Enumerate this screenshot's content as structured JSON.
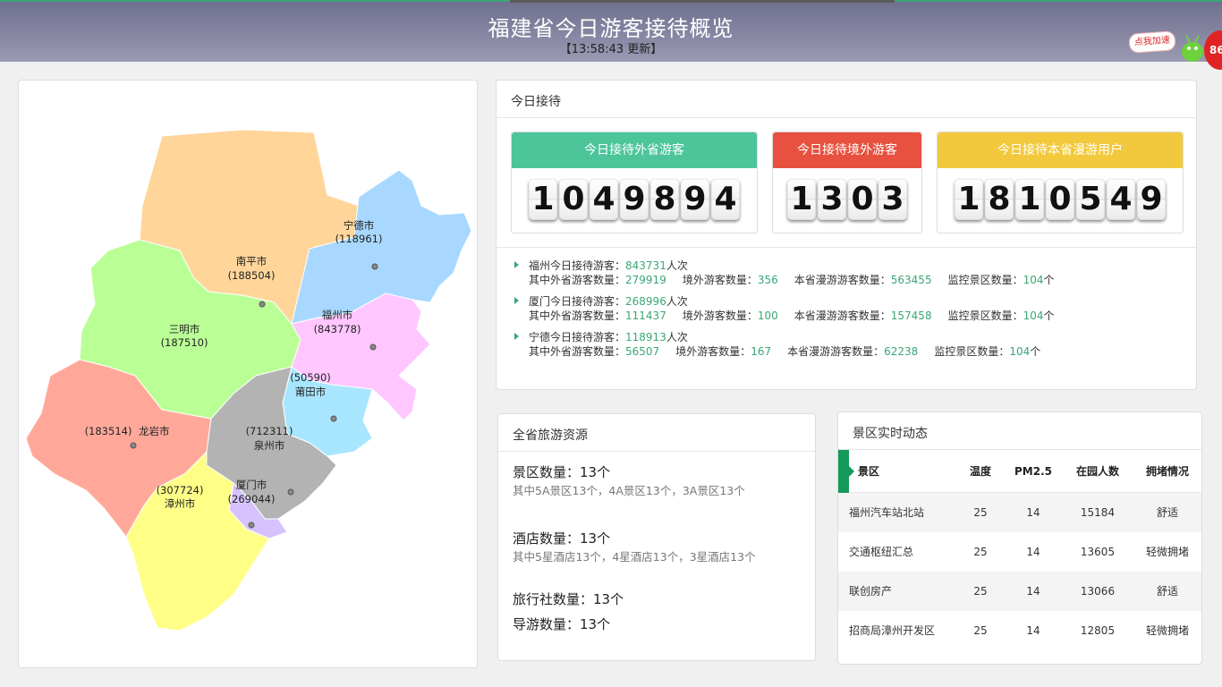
{
  "header": {
    "title": "福建省今日游客接待概览",
    "time": "【13:58:43 更新】",
    "speed_button": "点我加速",
    "speed_badge": "86"
  },
  "map": {
    "cities": [
      {
        "name": "宁德市",
        "value": "(118961)",
        "color": "#a8d8ff"
      },
      {
        "name": "南平市",
        "value": "(188504)",
        "color": "#ffd59a"
      },
      {
        "name": "三明市",
        "value": "(187510)",
        "color": "#b9ff96"
      },
      {
        "name": "福州市",
        "value": "(843778)",
        "color": "#ffc6ff"
      },
      {
        "name": "莆田市",
        "value": "(50590)",
        "color": "#a8e6ff"
      },
      {
        "name": "龙岩市",
        "value": "(183514)",
        "color": "#ffa89a"
      },
      {
        "name": "泉州市",
        "value": "(712311)",
        "color": "#b3b3b3"
      },
      {
        "name": "厦门市",
        "value": "(269044)",
        "color": "#d6c2ff"
      },
      {
        "name": "漳州市",
        "value": "(307724)",
        "color": "#ffff88"
      }
    ]
  },
  "today": {
    "title": "今日接待",
    "cards": [
      {
        "label": "今日接待外省游客",
        "digits": "1049894",
        "color": "#4cc59a"
      },
      {
        "label": "今日接待境外游客",
        "digits": "1303",
        "color": "#e8513f"
      },
      {
        "label": "今日接待本省漫游用户",
        "digits": "1810549",
        "color": "#f2c93c"
      }
    ],
    "labels": {
      "other_prov": "其中外省游客数量：",
      "foreign": "境外游客数量：",
      "roaming": "本省漫游游客数量：",
      "scenic": "监控景区数量：",
      "unit_people": "人次",
      "unit_count": "个"
    },
    "cities": [
      {
        "title": "福州今日接待游客：",
        "total": "843731",
        "other_prov": "279919",
        "foreign": "356",
        "roaming": "563455",
        "scenic": "104"
      },
      {
        "title": "厦门今日接待游客：",
        "total": "268996",
        "other_prov": "111437",
        "foreign": "100",
        "roaming": "157458",
        "scenic": "104"
      },
      {
        "title": "宁德今日接待游客：",
        "total": "118913",
        "other_prov": "56507",
        "foreign": "167",
        "roaming": "62238",
        "scenic": "104"
      }
    ]
  },
  "resources": {
    "title": "全省旅游资源",
    "scenic_count": "景区数量：13个",
    "scenic_detail": "其中5A景区13个，4A景区13个，3A景区13个",
    "hotel_count": "酒店数量：13个",
    "hotel_detail": "其中5星酒店13个，4星酒店13个，3星酒店13个",
    "agency_count": "旅行社数量：13个",
    "guide_count": "导游数量：13个"
  },
  "scenic": {
    "title": "景区实时动态",
    "columns": [
      "景区",
      "温度",
      "PM2.5",
      "在园人数",
      "拥堵情况"
    ],
    "rows": [
      [
        "福州汽车站北站",
        "25",
        "14",
        "15184",
        "舒适"
      ],
      [
        "交通枢纽汇总",
        "25",
        "14",
        "13605",
        "轻微拥堵"
      ],
      [
        "联创房产",
        "25",
        "14",
        "13066",
        "舒适"
      ],
      [
        "招商局漳州开发区",
        "25",
        "14",
        "12805",
        "轻微拥堵"
      ]
    ]
  }
}
